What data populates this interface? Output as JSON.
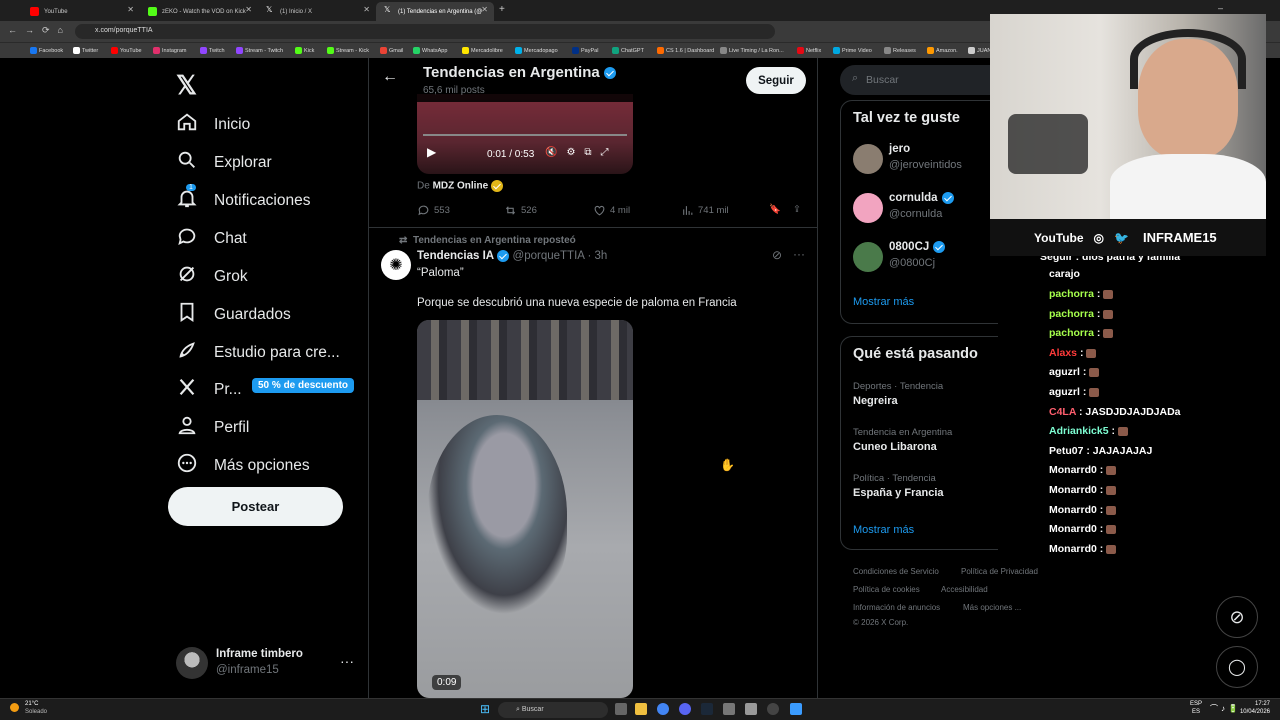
{
  "browser": {
    "tabs": [
      {
        "title": "YouTube",
        "color": "#ff0000"
      },
      {
        "title": "zEKO - Watch the VOD on Kick",
        "color": "#53fc18"
      },
      {
        "title": "(1) Inicio / X",
        "color": "#ffffff"
      },
      {
        "title": "(1) Tendencias en Argentina (@",
        "color": "#ffffff"
      }
    ],
    "url": "x.com/porqueTTIA",
    "bookmarks": [
      "Facebook",
      "Twitter",
      "YouTube",
      "Instagram",
      "Twitch",
      "Stream - Twitch",
      "Kick",
      "Stream - Kick",
      "Gmail",
      "WhatsApp",
      "Mercadolibre",
      "Mercadopago",
      "PayPal",
      "ChatGPT",
      "CS 1.6 | Dashboard",
      "Live Timing / La Ron...",
      "Netflix",
      "Prime Video",
      "Releases",
      "Amazon.",
      "JUAN"
    ]
  },
  "sidebar": {
    "items": [
      {
        "label": "Inicio",
        "icon": "home-icon"
      },
      {
        "label": "Explorar",
        "icon": "search-icon"
      },
      {
        "label": "Notificaciones",
        "icon": "bell-icon",
        "badge": "1"
      },
      {
        "label": "Chat",
        "icon": "chat-icon"
      },
      {
        "label": "Grok",
        "icon": "grok-icon"
      },
      {
        "label": "Guardados",
        "icon": "bookmark-icon"
      },
      {
        "label": "Estudio para cre...",
        "icon": "rocket-icon"
      },
      {
        "label": "Pr...",
        "icon": "x-premium-icon",
        "promo": "50 % de descuento"
      },
      {
        "label": "Perfil",
        "icon": "person-icon"
      },
      {
        "label": "Más opciones",
        "icon": "more-circle-icon"
      }
    ],
    "post_button": "Postear",
    "account": {
      "name": "Inframe timbero",
      "handle": "@inframe15"
    }
  },
  "header": {
    "title": "Tendencias en Argentina",
    "subtitle": "65,6 mil posts",
    "follow": "Seguir"
  },
  "tweet1": {
    "video_time": "0:01 / 0:53",
    "source_prefix": "De",
    "source": "MDZ Online",
    "replies": "553",
    "reposts": "526",
    "likes": "4 mil",
    "views": "741 mil"
  },
  "tweet2": {
    "reposted_by": "Tendencias en Argentina reposteó",
    "name": "Tendencias IA",
    "handle": "@porqueTTIA",
    "time": "· 3h",
    "quote": "“Paloma”",
    "text": "Porque se descubrió una nueva especie de paloma en Francia",
    "video_duration": "0:09"
  },
  "right": {
    "search_placeholder": "Buscar",
    "suggest_title": "Tal vez te guste",
    "suggestions": [
      {
        "name": "jero",
        "handle": "@jeroveintidos",
        "verified": false
      },
      {
        "name": "cornulda",
        "handle": "@cornulda",
        "verified": true
      },
      {
        "name": "0800CJ",
        "handle": "@0800Cj",
        "verified": true
      }
    ],
    "show_more": "Mostrar más",
    "trends_title": "Qué está pasando",
    "trends": [
      {
        "context": "Deportes · Tendencia",
        "topic": "Negreira"
      },
      {
        "context": "Tendencia en Argentina",
        "topic": "Cuneo Libarona"
      },
      {
        "context": "Política · Tendencia",
        "topic": "España y Francia"
      }
    ],
    "footer": [
      "Condiciones de Servicio",
      "Política de Privacidad",
      "Política de cookies",
      "Accesibilidad",
      "Información de anuncios",
      "Más opciones ...",
      "© 2026 X Corp."
    ]
  },
  "overlay": {
    "socials": [
      "YouTube",
      "INFRAME15"
    ],
    "chat": [
      {
        "user": "Seguir",
        "msg": "dios patria y familia",
        "color": "#ffffff"
      },
      {
        "user": "",
        "msg": "carajo",
        "color": "#ffffff"
      },
      {
        "user": "pachorra",
        "msg": "",
        "color": "#a6ff4d"
      },
      {
        "user": "pachorra",
        "msg": "",
        "color": "#a6ff4d"
      },
      {
        "user": "pachorra",
        "msg": "",
        "color": "#a6ff4d"
      },
      {
        "user": "Alaxs",
        "msg": "",
        "color": "#ff3b3b"
      },
      {
        "user": "aguzrl",
        "msg": "",
        "color": "#ffffff"
      },
      {
        "user": "aguzrl",
        "msg": "",
        "color": "#ffffff"
      },
      {
        "user": "C4LA",
        "msg": "JASDJDJAJDJADa",
        "color": "#ff5f6e"
      },
      {
        "user": "Adriankick5",
        "msg": "",
        "color": "#7fffd4"
      },
      {
        "user": "Petu07",
        "msg": "JAJAJAJAJ",
        "color": "#ffffff"
      },
      {
        "user": "Monarrd0",
        "msg": "",
        "color": "#ffffff"
      },
      {
        "user": "Monarrd0",
        "msg": "",
        "color": "#ffffff"
      },
      {
        "user": "Monarrd0",
        "msg": "",
        "color": "#ffffff"
      },
      {
        "user": "Monarrd0",
        "msg": "",
        "color": "#ffffff"
      },
      {
        "user": "Monarrd0",
        "msg": "",
        "color": "#ffffff"
      }
    ]
  },
  "taskbar": {
    "weather_temp": "21°C",
    "weather_desc": "Soleado",
    "search": "Buscar",
    "lang": "ESP",
    "lang2": "ES",
    "time": "17:27",
    "date": "10/04/2026"
  }
}
